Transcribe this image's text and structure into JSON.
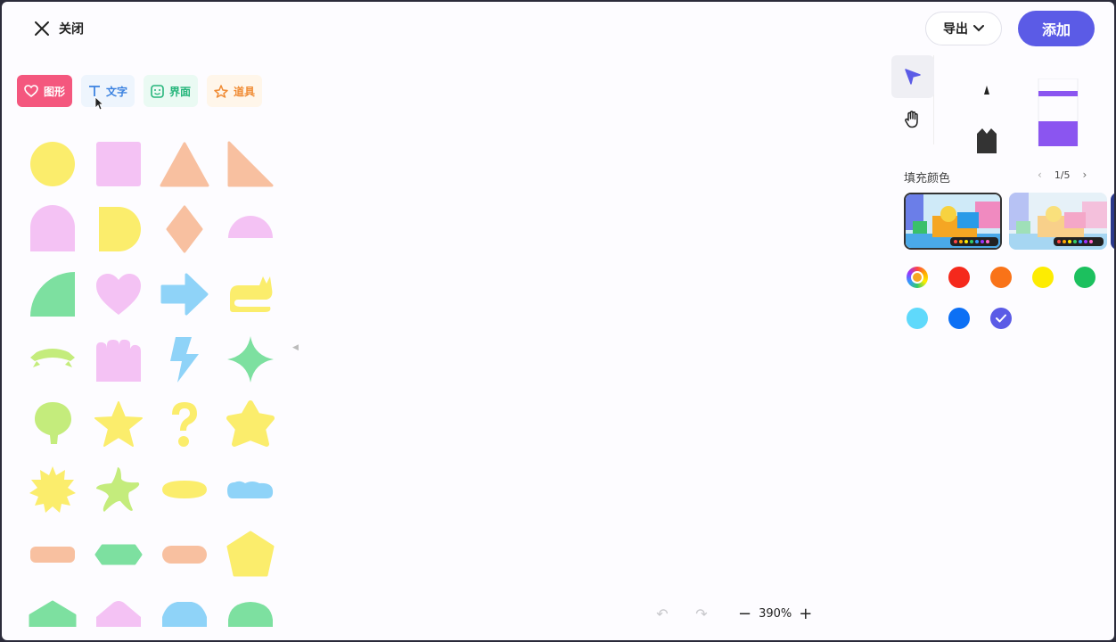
{
  "header": {
    "close_label": "关闭",
    "export_label": "导出",
    "add_label": "添加"
  },
  "tabs": [
    {
      "label": "图形",
      "icon": "heart-icon",
      "active": true
    },
    {
      "label": "文字",
      "icon": "text-icon",
      "active": false
    },
    {
      "label": "界面",
      "icon": "sticker-icon",
      "active": false
    },
    {
      "label": "道具",
      "icon": "prop-icon",
      "active": false
    }
  ],
  "shapes": [
    {
      "name": "circle",
      "color": "#fbed6c"
    },
    {
      "name": "square",
      "color": "#f4c2f4"
    },
    {
      "name": "triangle",
      "color": "#f8c0a0"
    },
    {
      "name": "right-triangle",
      "color": "#f8c0a0"
    },
    {
      "name": "arch",
      "color": "#f4c2f4"
    },
    {
      "name": "d-shape",
      "color": "#fbed6c"
    },
    {
      "name": "diamond",
      "color": "#f8c0a0"
    },
    {
      "name": "semicircle",
      "color": "#f4c2f4"
    },
    {
      "name": "quarter-circle",
      "color": "#7de0a0"
    },
    {
      "name": "heart",
      "color": "#f4c2f4"
    },
    {
      "name": "arrow",
      "color": "#8fd3f8"
    },
    {
      "name": "cat",
      "color": "#fbed6c"
    },
    {
      "name": "ribbon",
      "color": "#c4ec7c"
    },
    {
      "name": "castle",
      "color": "#f4c2f4"
    },
    {
      "name": "lightning",
      "color": "#8fd3f8"
    },
    {
      "name": "sparkle",
      "color": "#7de0a0"
    },
    {
      "name": "balloon",
      "color": "#c4ec7c"
    },
    {
      "name": "star",
      "color": "#fbed6c"
    },
    {
      "name": "question-mark",
      "color": "#fbed6c"
    },
    {
      "name": "rounded-star",
      "color": "#fbed6c"
    },
    {
      "name": "sun",
      "color": "#fbed6c"
    },
    {
      "name": "starfish",
      "color": "#c4ec7c"
    },
    {
      "name": "lens",
      "color": "#fbed6c"
    },
    {
      "name": "cloud",
      "color": "#8fd3f8"
    },
    {
      "name": "pill",
      "color": "#f8c0a0"
    },
    {
      "name": "hexagon-wide",
      "color": "#7de0a0"
    },
    {
      "name": "stadium",
      "color": "#f8c0a0"
    },
    {
      "name": "pentagon",
      "color": "#fbed6c"
    },
    {
      "name": "house",
      "color": "#7de0a0"
    },
    {
      "name": "house-soft",
      "color": "#f4c2f4"
    },
    {
      "name": "dome",
      "color": "#8fd3f8"
    },
    {
      "name": "dome-round",
      "color": "#7de0a0"
    }
  ],
  "tools": [
    {
      "name": "select-tool",
      "icon": "cursor-icon",
      "active": true
    },
    {
      "name": "hand-tool",
      "icon": "hand-icon",
      "active": false
    }
  ],
  "fill": {
    "label": "填充颜色",
    "page": "1/5",
    "selected_color": "#5b5be6"
  },
  "colors": [
    {
      "name": "gradient",
      "hex": "rainbow"
    },
    {
      "name": "red",
      "hex": "#f5291c"
    },
    {
      "name": "orange",
      "hex": "#f97318"
    },
    {
      "name": "yellow",
      "hex": "#fdec02"
    },
    {
      "name": "green",
      "hex": "#1cc05e"
    },
    {
      "name": "light-blue",
      "hex": "#5fd9fb"
    },
    {
      "name": "blue",
      "hex": "#0c70f5"
    },
    {
      "name": "purple",
      "hex": "#5b5be6",
      "selected": true
    }
  ],
  "zoom": {
    "value": "390%"
  }
}
